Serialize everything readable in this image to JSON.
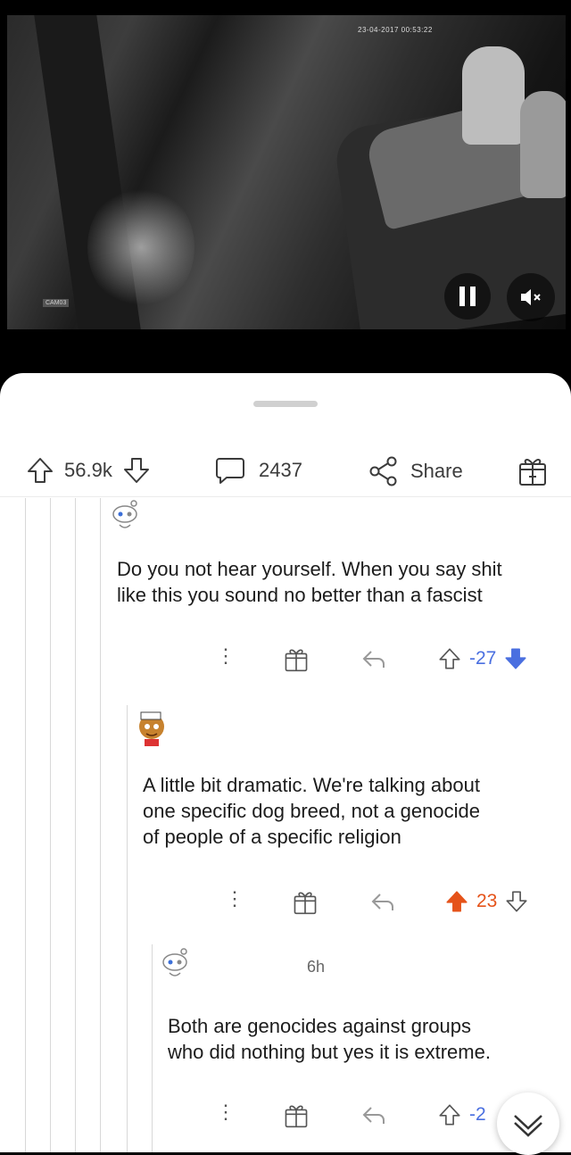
{
  "video": {
    "timestamp": "23-04-2017 00:53:22",
    "camera_label": "CAM03",
    "play_state_icon": "pause-icon",
    "sound_icon": "mute-icon"
  },
  "post_actions": {
    "upvotes": "56.9k",
    "comments": "2437",
    "share_label": "Share"
  },
  "comments": [
    {
      "username": "",
      "text_line1": "Do you not hear yourself. When you say shit",
      "text_line2": "like this you sound no better than a fascist",
      "score": "-27",
      "vote_state": "downvoted"
    },
    {
      "username": "",
      "text_line1": "A little bit dramatic. We're talking about",
      "text_line2": "one specific dog breed, not a genocide",
      "text_line3": "of people of a specific religion",
      "score": "23",
      "vote_state": "upvoted"
    },
    {
      "username": "",
      "age": "6h",
      "text_line1": "Both are genocides against groups",
      "text_line2": "who did nothing but yes it is extreme.",
      "score": "-2",
      "vote_state": "none"
    }
  ],
  "colors": {
    "upvote": "#e5531a",
    "downvote": "#4a6fe0",
    "text": "#1c1c1c"
  }
}
